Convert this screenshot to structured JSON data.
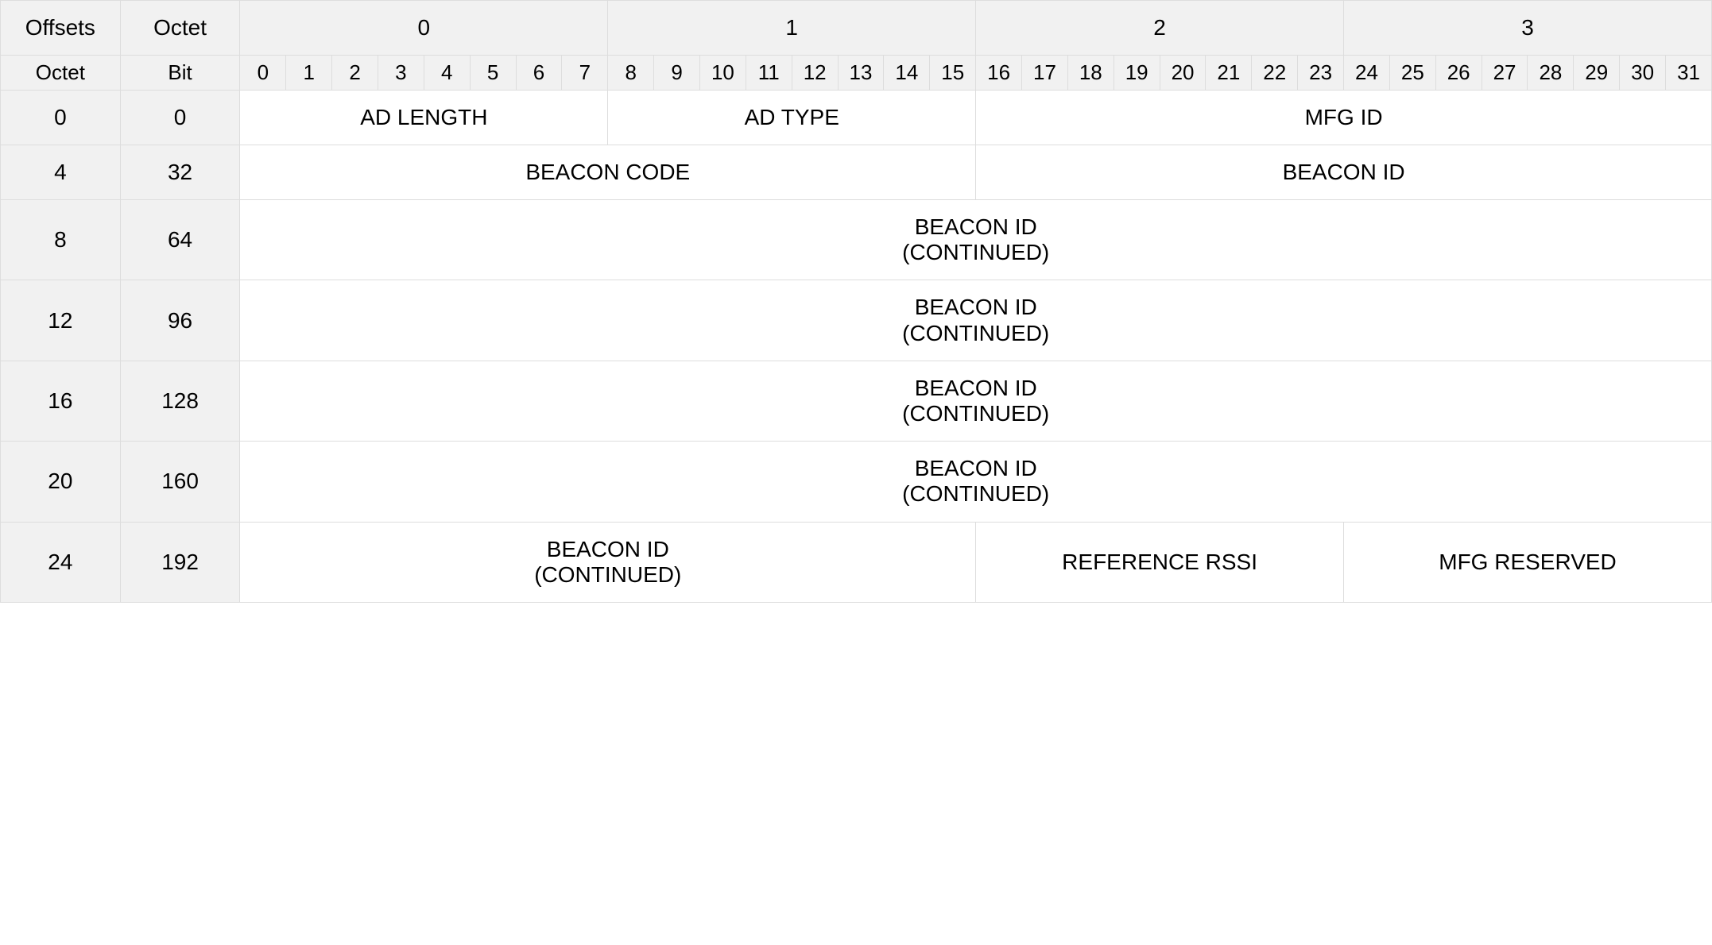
{
  "header": {
    "offsets": "Offsets",
    "octet": "Octet",
    "bit": "Bit",
    "octetGroups": [
      "0",
      "1",
      "2",
      "3"
    ],
    "bits": [
      "0",
      "1",
      "2",
      "3",
      "4",
      "5",
      "6",
      "7",
      "8",
      "9",
      "10",
      "11",
      "12",
      "13",
      "14",
      "15",
      "16",
      "17",
      "18",
      "19",
      "20",
      "21",
      "22",
      "23",
      "24",
      "25",
      "26",
      "27",
      "28",
      "29",
      "30",
      "31"
    ]
  },
  "rows": [
    {
      "octet": "0",
      "bit": "0",
      "fields": [
        {
          "label": "AD LENGTH",
          "span": 8
        },
        {
          "label": "AD TYPE",
          "span": 8
        },
        {
          "label": "MFG ID",
          "span": 16
        }
      ]
    },
    {
      "octet": "4",
      "bit": "32",
      "fields": [
        {
          "label": "BEACON CODE",
          "span": 16
        },
        {
          "label": "BEACON ID",
          "span": 16
        }
      ]
    },
    {
      "octet": "8",
      "bit": "64",
      "fields": [
        {
          "label": "BEACON ID\n(CONTINUED)",
          "span": 32
        }
      ]
    },
    {
      "octet": "12",
      "bit": "96",
      "fields": [
        {
          "label": "BEACON ID\n(CONTINUED)",
          "span": 32
        }
      ]
    },
    {
      "octet": "16",
      "bit": "128",
      "fields": [
        {
          "label": "BEACON ID\n(CONTINUED)",
          "span": 32
        }
      ]
    },
    {
      "octet": "20",
      "bit": "160",
      "fields": [
        {
          "label": "BEACON ID\n(CONTINUED)",
          "span": 32
        }
      ]
    },
    {
      "octet": "24",
      "bit": "192",
      "fields": [
        {
          "label": "BEACON ID\n(CONTINUED)",
          "span": 16
        },
        {
          "label": "REFERENCE RSSI",
          "span": 8
        },
        {
          "label": "MFG RESERVED",
          "span": 8
        }
      ]
    }
  ]
}
